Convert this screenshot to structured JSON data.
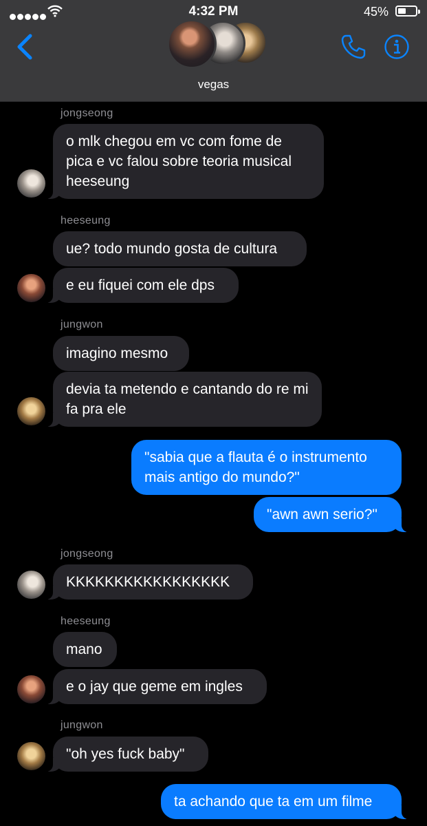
{
  "status_bar": {
    "time": "4:32 PM",
    "battery_percent": "45%",
    "battery_level": 0.45,
    "signal_bars": 5
  },
  "header": {
    "group_name": "vegas",
    "back_icon": "chevron-left-icon",
    "call_icon": "phone-icon",
    "info_icon": "info-icon",
    "accent_color": "#0a7cff"
  },
  "messages": {
    "jongseong_name_1": "jongseong",
    "m1": "o mlk chegou em vc com fome de pica e vc falou sobre teoria musical heeseung",
    "heeseung_name_1": "heeseung",
    "m2": "ue? todo mundo gosta de cultura",
    "m3": "e eu fiquei com ele dps",
    "jungwon_name_1": "jungwon",
    "m4": "imagino mesmo",
    "m5": "devia ta metendo e cantando do re mi fa pra ele",
    "m6": "\"sabia que a flauta é o instrumento mais antigo do mundo?\"",
    "m7": "\"awn awn serio?\"",
    "jongseong_name_2": "jongseong",
    "m8": "KKKKKKKKKKKKKKKKK",
    "heeseung_name_2": "heeseung",
    "m9": "mano",
    "m10": "e o jay que geme em ingles",
    "jungwon_name_2": "jungwon",
    "m11": "\"oh yes fuck baby\"",
    "m12": "ta achando que ta em um filme"
  },
  "colors": {
    "incoming_bubble": "#26252a",
    "outgoing_bubble": "#0a7cff",
    "header_bg": "#3a3a3c",
    "sender_label": "#8e8e93"
  }
}
